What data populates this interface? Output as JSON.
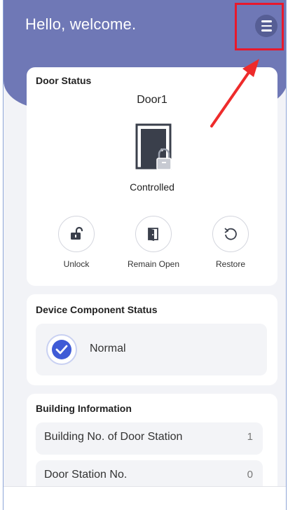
{
  "header": {
    "greeting": "Hello, welcome."
  },
  "door_status": {
    "title": "Door Status",
    "door_name": "Door1",
    "state": "Controlled",
    "actions": [
      {
        "label": "Unlock",
        "icon": "unlock-icon"
      },
      {
        "label": "Remain Open",
        "icon": "remain-open-icon"
      },
      {
        "label": "Restore",
        "icon": "restore-icon"
      }
    ]
  },
  "device_component": {
    "title": "Device Component Status",
    "status": "Normal"
  },
  "building_info": {
    "title": "Building Information",
    "rows": [
      {
        "label": "Building No. of Door Station",
        "value": "1"
      },
      {
        "label": "Door Station No.",
        "value": "0"
      }
    ]
  },
  "colors": {
    "header_bg": "#6f78b6",
    "highlight": "#e8192c",
    "accent_blue": "#3f5bd6"
  }
}
